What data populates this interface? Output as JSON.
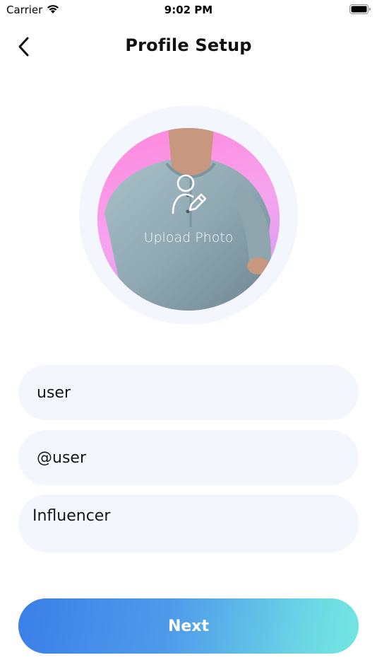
{
  "status_bar": {
    "carrier": "Carrier",
    "time": "9:02 PM",
    "icons": [
      "wifi-icon",
      "battery-icon"
    ]
  },
  "header": {
    "title": "Profile Setup",
    "back_icon": "chevron-left-icon"
  },
  "avatar": {
    "upload_label": "Upload Photo",
    "upload_icon": "user-edit-icon",
    "colors": {
      "ring": "#f3f6fc",
      "background": "#f7a0ef"
    }
  },
  "form": {
    "name_value": "user",
    "username_value": "@user",
    "category_value": "Influencer"
  },
  "actions": {
    "next_label": "Next"
  },
  "colors": {
    "field_background": "#f3f7fd",
    "button_gradient_start": "#3b7fe8",
    "button_gradient_end": "#72e6e0"
  }
}
